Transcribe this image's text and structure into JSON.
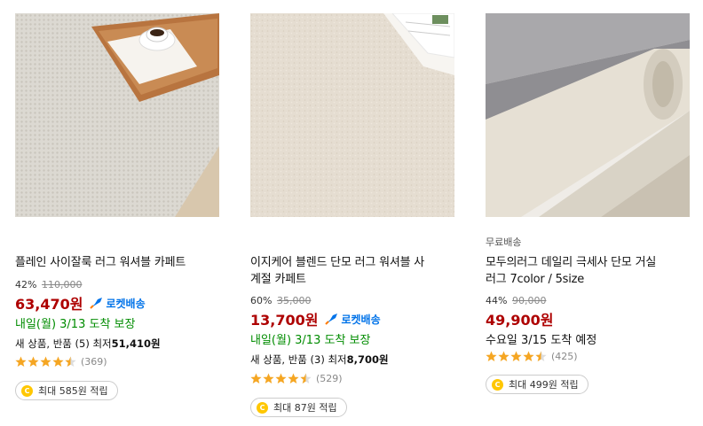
{
  "products": [
    {
      "title": "플레인 사이잘룩 러그 워셔블 카페트",
      "discount_rate": "42%",
      "original_price": "110,000",
      "price": "63,470원",
      "rocket_label": "로켓배송",
      "delivery": "내일(월) 3/13 도착 보장",
      "other_prefix": "새 상품, 반품 (5) 최저",
      "other_price": "51,410원",
      "rating": 4.5,
      "review_count": "(369)",
      "reward": "최대 585원 적립"
    },
    {
      "title_line1": "이지케어 블렌드 단모 러그 워셔블 사",
      "title_line2": "계절 카페트",
      "discount_rate": "60%",
      "original_price": "35,000",
      "price": "13,700원",
      "rocket_label": "로켓배송",
      "delivery": "내일(월) 3/13 도착 보장",
      "other_prefix": "새 상품, 반품 (3) 최저",
      "other_price": "8,700원",
      "rating": 4.5,
      "review_count": "(529)",
      "reward": "최대 87원 적립"
    },
    {
      "tag": "무료배송",
      "title_line1": "모두의러그 데일리 극세사 단모 거실",
      "title_line2": "러그 7color / 5size",
      "discount_rate": "44%",
      "original_price": "90,000",
      "price": "49,900원",
      "delivery": "수요일 3/15 도착 예정",
      "rating": 4.5,
      "review_count": "(425)",
      "reward": "최대 499원 적립"
    }
  ],
  "colors": {
    "price": "#ae0000",
    "rocket": "#0073e9",
    "delivery_green": "#008c00",
    "star": "#f5a623",
    "coin": "#ffc700"
  },
  "icons": {
    "rocket": "rocket-icon",
    "coin": "coin-icon",
    "star": "star-icon"
  }
}
